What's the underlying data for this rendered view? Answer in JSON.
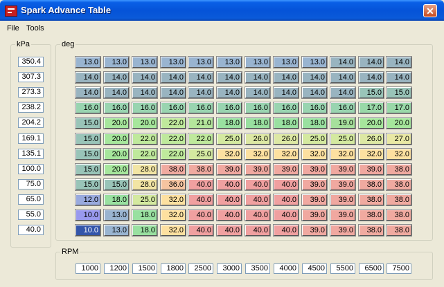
{
  "window": {
    "title": "Spark Advance Table",
    "close_glyph": "✕"
  },
  "menu": [
    "File",
    "Tools"
  ],
  "kpa_group_label": "kPa",
  "deg_group_label": "deg",
  "rpm_group_label": "RPM",
  "kpa": [
    "350.4",
    "307.3",
    "273.3",
    "238.2",
    "204.2",
    "169.1",
    "135.1",
    "100.0",
    "75.0",
    "65.0",
    "55.0",
    "40.0"
  ],
  "rpm": [
    "1000",
    "1200",
    "1500",
    "1800",
    "2500",
    "3000",
    "3500",
    "4000",
    "4500",
    "5500",
    "6500",
    "7500"
  ],
  "table": [
    [
      "13.0",
      "13.0",
      "13.0",
      "13.0",
      "13.0",
      "13.0",
      "13.0",
      "13.0",
      "13.0",
      "14.0",
      "14.0",
      "14.0"
    ],
    [
      "14.0",
      "14.0",
      "14.0",
      "14.0",
      "14.0",
      "14.0",
      "14.0",
      "14.0",
      "14.0",
      "14.0",
      "14.0",
      "14.0"
    ],
    [
      "14.0",
      "14.0",
      "14.0",
      "14.0",
      "14.0",
      "14.0",
      "14.0",
      "14.0",
      "14.0",
      "14.0",
      "15.0",
      "15.0"
    ],
    [
      "16.0",
      "16.0",
      "16.0",
      "16.0",
      "16.0",
      "16.0",
      "16.0",
      "16.0",
      "16.0",
      "16.0",
      "17.0",
      "17.0"
    ],
    [
      "15.0",
      "20.0",
      "20.0",
      "22.0",
      "21.0",
      "18.0",
      "18.0",
      "18.0",
      "18.0",
      "19.0",
      "20.0",
      "20.0"
    ],
    [
      "15.0",
      "20.0",
      "22.0",
      "22.0",
      "22.0",
      "25.0",
      "26.0",
      "26.0",
      "25.0",
      "25.0",
      "26.0",
      "27.0"
    ],
    [
      "15.0",
      "20.0",
      "22.0",
      "22.0",
      "25.0",
      "32.0",
      "32.0",
      "32.0",
      "32.0",
      "32.0",
      "32.0",
      "32.0"
    ],
    [
      "15.0",
      "20.0",
      "28.0",
      "38.0",
      "38.0",
      "39.0",
      "39.0",
      "39.0",
      "39.0",
      "39.0",
      "39.0",
      "38.0"
    ],
    [
      "15.0",
      "15.0",
      "28.0",
      "36.0",
      "40.0",
      "40.0",
      "40.0",
      "40.0",
      "39.0",
      "39.0",
      "38.0",
      "38.0"
    ],
    [
      "12.0",
      "18.0",
      "25.0",
      "32.0",
      "40.0",
      "40.0",
      "40.0",
      "40.0",
      "39.0",
      "39.0",
      "38.0",
      "38.0"
    ],
    [
      "10.0",
      "13.0",
      "18.0",
      "32.0",
      "40.0",
      "40.0",
      "40.0",
      "40.0",
      "39.0",
      "39.0",
      "38.0",
      "38.0"
    ],
    [
      "10.0",
      "13.0",
      "18.0",
      "32.0",
      "40.0",
      "40.0",
      "40.0",
      "40.0",
      "39.0",
      "39.0",
      "38.0",
      "38.0"
    ]
  ],
  "selected_cell": {
    "row": 11,
    "col": 0
  },
  "colors": {
    "v10": "#9999ee",
    "v12": "#99aade",
    "v13": "#99b4d0",
    "v14": "#99b4c0",
    "v15": "#99c4b8",
    "v16": "#99d4b0",
    "v17": "#99d8a8",
    "v18": "#99e0a0",
    "v19": "#a6e09c",
    "v20": "#a6e69c",
    "v21": "#b4e69c",
    "v22": "#bfe99c",
    "v25": "#d4e9a0",
    "v26": "#dde8a4",
    "v27": "#e9e8a4",
    "v28": "#f2e5a4",
    "v32": "#fde0a0",
    "v36": "#f5c4a0",
    "v38": "#f0aaa0",
    "v39": "#f0a8a0",
    "v40": "#f0a0a0"
  }
}
